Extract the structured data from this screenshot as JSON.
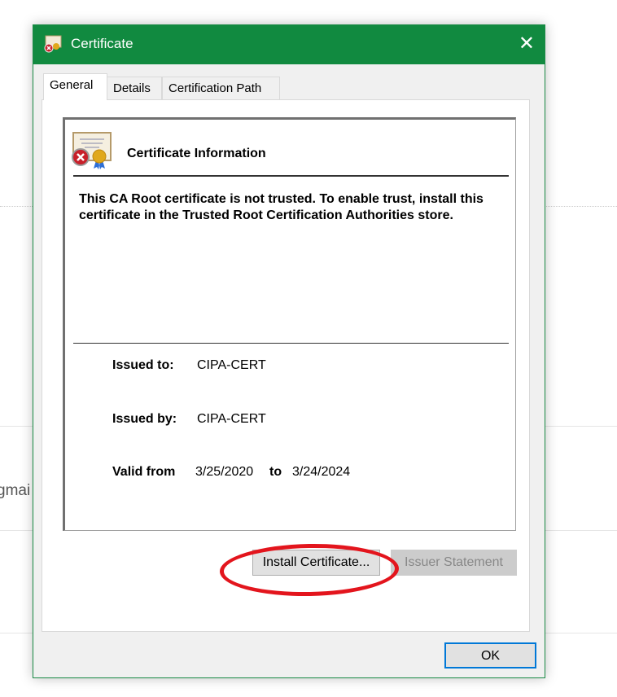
{
  "background": {
    "partial_text": "gmai"
  },
  "dialog": {
    "title": "Certificate",
    "close_glyph": "✕",
    "tabs": [
      {
        "label": "General",
        "active": true
      },
      {
        "label": "Details"
      },
      {
        "label": "Certification Path"
      }
    ],
    "heading": "Certificate Information",
    "message": "This CA Root certificate is not trusted. To enable trust, install this certificate in the Trusted Root Certification Authorities store.",
    "issued_to_label": "Issued to:",
    "issued_to": "CIPA-CERT",
    "issued_by_label": "Issued by:",
    "issued_by": "CIPA-CERT",
    "valid_from_label": "Valid from",
    "valid_from": "3/25/2020",
    "to_label": "to",
    "valid_to": "3/24/2024",
    "install_label": "Install Certificate...",
    "issuer_label": "Issuer Statement",
    "ok_label": "OK"
  },
  "colors": {
    "titlebar": "#118a40",
    "highlight_ellipse": "#e3151d",
    "focus": "#0078d7"
  }
}
